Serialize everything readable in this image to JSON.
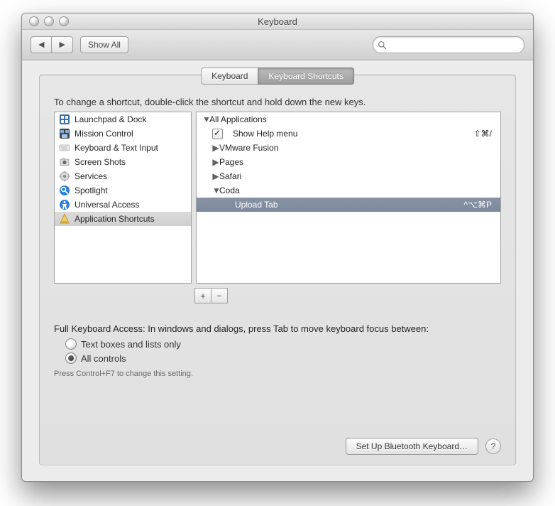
{
  "window": {
    "title": "Keyboard"
  },
  "toolbar": {
    "back_icon": "chevron-left",
    "forward_icon": "chevron-right",
    "show_all_label": "Show All",
    "search_placeholder": ""
  },
  "tabs": [
    {
      "id": "keyboard",
      "label": "Keyboard",
      "active": false
    },
    {
      "id": "keyboard-shortcuts",
      "label": "Keyboard Shortcuts",
      "active": true
    }
  ],
  "instructions": "To change a shortcut, double-click the shortcut and hold down the new keys.",
  "categories": [
    {
      "icon": "launchpad",
      "label": "Launchpad & Dock"
    },
    {
      "icon": "mission",
      "label": "Mission Control"
    },
    {
      "icon": "textinput",
      "label": "Keyboard & Text Input"
    },
    {
      "icon": "screenshots",
      "label": "Screen Shots"
    },
    {
      "icon": "services",
      "label": "Services"
    },
    {
      "icon": "spotlight",
      "label": "Spotlight"
    },
    {
      "icon": "universal",
      "label": "Universal Access"
    },
    {
      "icon": "appshortcuts",
      "label": "Application Shortcuts",
      "selected": true
    }
  ],
  "shortcuts_tree": {
    "all_apps_label": "All Applications",
    "show_help_menu": {
      "label": "Show Help menu",
      "shortcut": "⇧⌘/",
      "checked": true
    },
    "vmware_label": "VMware Fusion",
    "pages_label": "Pages",
    "safari_label": "Safari",
    "coda_label": "Coda",
    "upload_tab": {
      "label": "Upload Tab",
      "shortcut": "^⌥⌘P",
      "selected": true
    }
  },
  "add_label": "+",
  "remove_label": "−",
  "fka": {
    "heading": "Full Keyboard Access: In windows and dialogs, press Tab to move keyboard focus between:",
    "opt1": "Text boxes and lists only",
    "opt2": "All controls",
    "selected": "opt2",
    "hint": "Press Control+F7 to change this setting."
  },
  "footer": {
    "bluetooth_label": "Set Up Bluetooth Keyboard…",
    "help_label": "?"
  }
}
